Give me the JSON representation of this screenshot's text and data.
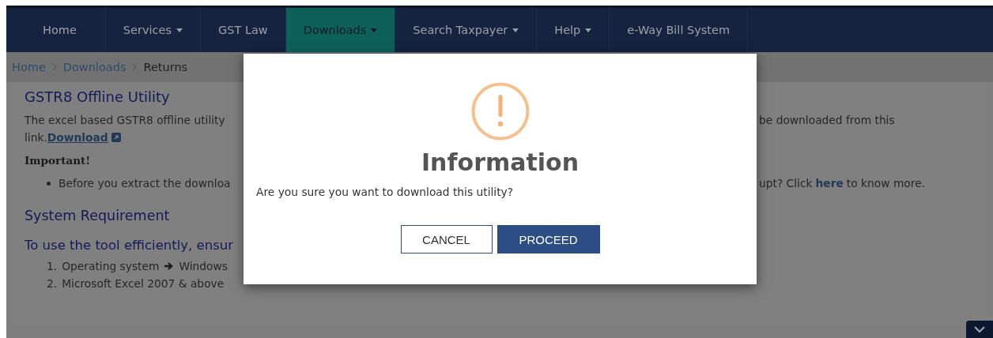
{
  "nav": [
    {
      "label": "Home",
      "dropdown": false,
      "selected": false
    },
    {
      "label": "Services",
      "dropdown": true,
      "selected": false
    },
    {
      "label": "GST Law",
      "dropdown": false,
      "selected": false
    },
    {
      "label": "Downloads",
      "dropdown": true,
      "selected": true
    },
    {
      "label": "Search Taxpayer",
      "dropdown": true,
      "selected": false
    },
    {
      "label": "Help",
      "dropdown": true,
      "selected": false
    },
    {
      "label": "e-Way Bill System",
      "dropdown": false,
      "selected": false
    }
  ],
  "breadcrumb": [
    {
      "label": "Home",
      "kind": "link"
    },
    {
      "label": "Downloads",
      "kind": "link"
    },
    {
      "label": "Returns",
      "kind": "current"
    }
  ],
  "section": {
    "heading": "GSTR8 Offline Utility",
    "intro": {
      "left": "The excel based GSTR8 offline utility",
      "right": "be downloaded from this",
      "line2": "link.",
      "link": "Download"
    },
    "important": "Important!",
    "bullet": {
      "left": "Before you extract the downloa",
      "right": "upt? Click",
      "link": "here",
      "after": "to know more."
    }
  },
  "requirements": {
    "heading": "System Requirement",
    "intro": "To use the tool efficiently, ensur",
    "items": [
      {
        "number": "1.",
        "text": "Operating system"
      },
      {
        "number": "2.",
        "text": "Microsoft Excel 2007 & above"
      }
    ],
    "item_1_value": "Windows"
  },
  "dialog": {
    "title": "Information",
    "message": "Are you sure you want to download this utility?",
    "buttons": [
      {
        "label": "CANCEL",
        "kind": "secondary"
      },
      {
        "label": "PROCEED",
        "kind": "primary"
      }
    ]
  }
}
